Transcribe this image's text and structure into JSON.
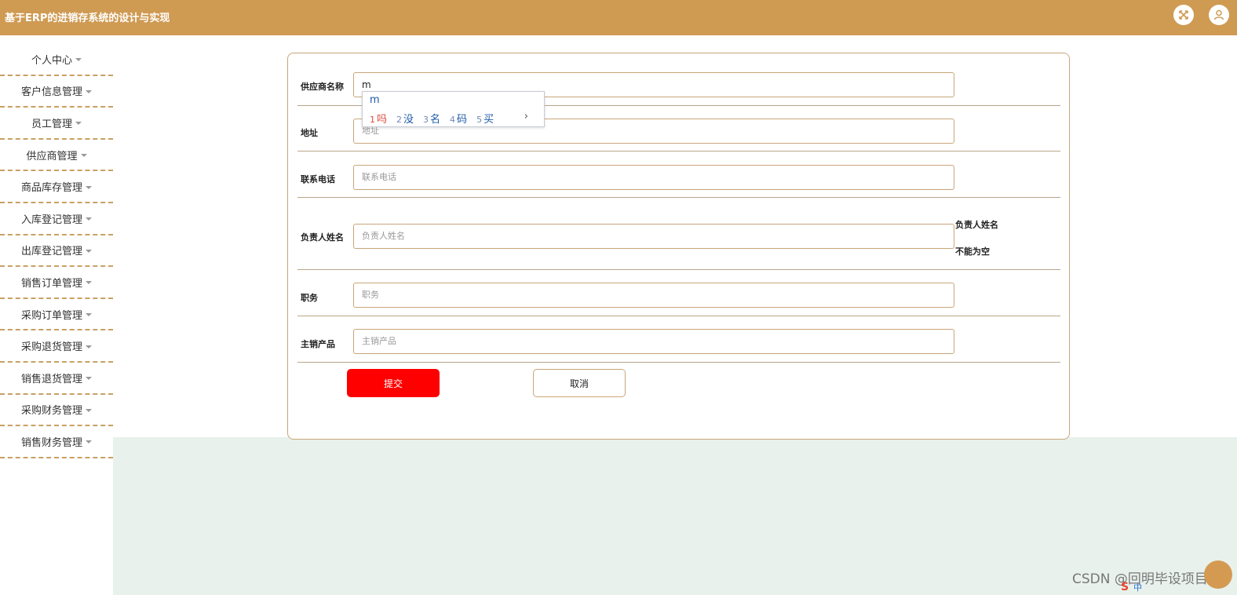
{
  "header": {
    "title": "基于ERP的进销存系统的设计与实现",
    "fullscreen_icon": "fullscreen-icon",
    "user_icon": "user-icon"
  },
  "sidebar": {
    "items": [
      {
        "label": "个人中心"
      },
      {
        "label": "客户信息管理"
      },
      {
        "label": "员工管理"
      },
      {
        "label": "供应商管理"
      },
      {
        "label": "商品库存管理"
      },
      {
        "label": "入库登记管理"
      },
      {
        "label": "出库登记管理"
      },
      {
        "label": "销售订单管理"
      },
      {
        "label": "采购订单管理"
      },
      {
        "label": "采购退货管理"
      },
      {
        "label": "销售退货管理"
      },
      {
        "label": "采购财务管理"
      },
      {
        "label": "销售财务管理"
      }
    ]
  },
  "form": {
    "fields": [
      {
        "label": "供应商名称",
        "value": "m",
        "placeholder": ""
      },
      {
        "label": "地址",
        "value": "",
        "placeholder": "地址"
      },
      {
        "label": "联系电话",
        "value": "",
        "placeholder": "联系电话"
      },
      {
        "label": "负责人姓名",
        "value": "",
        "placeholder": "负责人姓名",
        "error_line1": "负责人姓名",
        "error_line2": "不能为空"
      },
      {
        "label": "职务",
        "value": "",
        "placeholder": "职务"
      },
      {
        "label": "主销产品",
        "value": "",
        "placeholder": "主销产品"
      }
    ],
    "submit_label": "提交",
    "cancel_label": "取消"
  },
  "ime": {
    "composition": "m",
    "candidates": [
      {
        "num": "1",
        "word": "吗"
      },
      {
        "num": "2",
        "word": "没"
      },
      {
        "num": "3",
        "word": "名"
      },
      {
        "num": "4",
        "word": "码"
      },
      {
        "num": "5",
        "word": "买"
      }
    ],
    "next": "›"
  },
  "watermark": "CSDN @回明毕设项目",
  "tray": {
    "s": "S",
    "zh": "中"
  },
  "colors": {
    "header": "#cf9a52",
    "submit": "#ff0000",
    "border": "#c9a67a",
    "panel_bg": "#e8f1ec"
  }
}
